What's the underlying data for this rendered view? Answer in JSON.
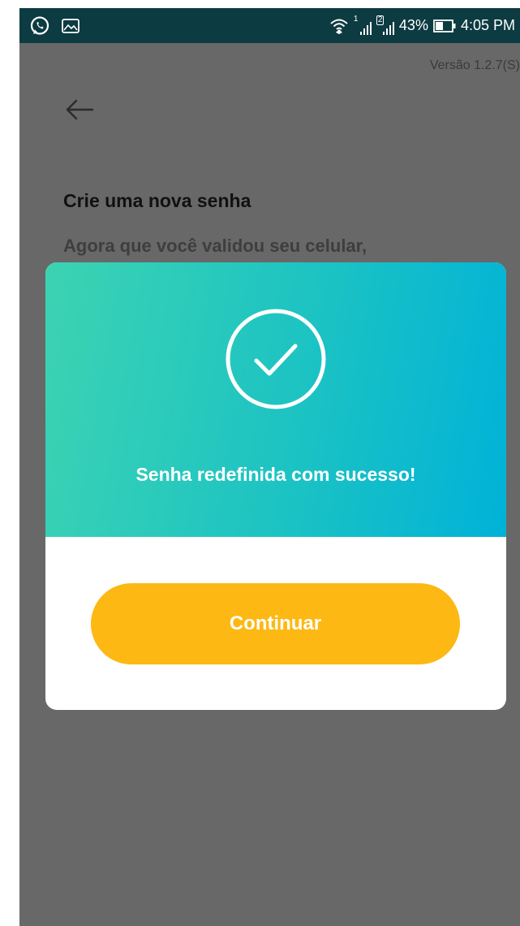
{
  "status_bar": {
    "battery_percent": "43%",
    "time": "4:05 PM",
    "sim1_label": "1",
    "sim2_label": "2",
    "icons": [
      "whatsapp-icon",
      "image-icon",
      "wifi-icon",
      "signal-icon",
      "signal-icon",
      "battery-icon"
    ]
  },
  "app": {
    "version": "Versão 1.2.7(S)",
    "title": "Crie uma nova senha",
    "subtitle": "Agora que você validou seu celular,"
  },
  "modal": {
    "message": "Senha redefinida com sucesso!",
    "continue_label": "Continuar",
    "icon": "check-circle-icon"
  },
  "colors": {
    "overlay": "#686868",
    "status_bar": "#0c3b42",
    "gradient_start": "#3cd3b2",
    "gradient_end": "#00b2d8",
    "button": "#fdb813"
  }
}
